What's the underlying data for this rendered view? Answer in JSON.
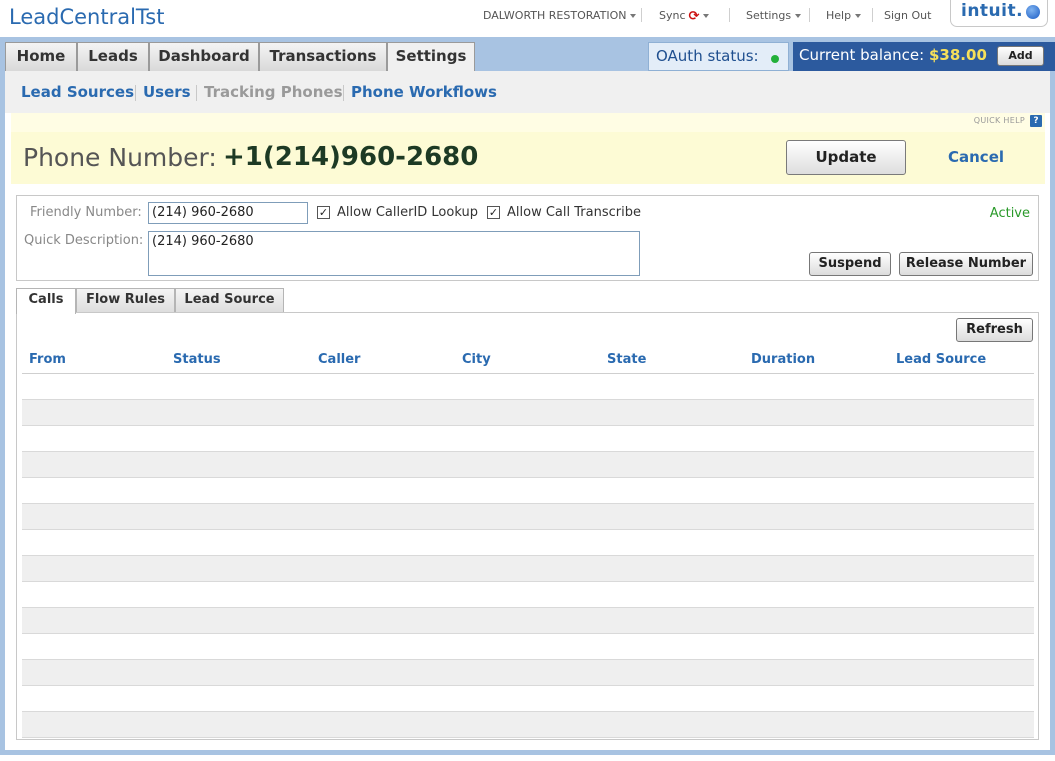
{
  "header": {
    "app_title": "LeadCentralTst",
    "company": "DALWORTH RESTORATION",
    "sync_label": "Sync",
    "settings_label": "Settings",
    "help_label": "Help",
    "signout_label": "Sign Out",
    "brand": "intuit."
  },
  "main_tabs": {
    "home": "Home",
    "leads": "Leads",
    "dashboard": "Dashboard",
    "transactions": "Transactions",
    "settings": "Settings"
  },
  "oauth": {
    "label": "OAuth status:",
    "status_color": "#22b03a"
  },
  "balance": {
    "label": "Current balance:",
    "amount": "$38.00",
    "add_label": "Add"
  },
  "subnav": {
    "lead_sources": "Lead Sources",
    "users": "Users",
    "tracking_phones": "Tracking Phones",
    "phone_workflows": "Phone Workflows"
  },
  "quick_help": {
    "label": "QUICK HELP",
    "icon": "?"
  },
  "phone": {
    "label": "Phone Number:",
    "number": "+1(214)960-2680",
    "update_label": "Update",
    "cancel_label": "Cancel"
  },
  "details": {
    "friendly_label": "Friendly Number:",
    "friendly_value": "(214) 960-2680",
    "caller_id_label": "Allow CallerID Lookup",
    "caller_id_checked": true,
    "transcribe_label": "Allow Call Transcribe",
    "transcribe_checked": true,
    "description_label": "Quick Description:",
    "description_value": "(214) 960-2680",
    "status": "Active",
    "suspend_label": "Suspend",
    "release_label": "Release Number"
  },
  "lower_tabs": {
    "calls": "Calls",
    "flow_rules": "Flow Rules",
    "lead_source": "Lead Source"
  },
  "calls_table": {
    "refresh_label": "Refresh",
    "columns": [
      "From",
      "Status",
      "Caller",
      "City",
      "State",
      "Duration",
      "Lead Source"
    ],
    "rows": []
  }
}
